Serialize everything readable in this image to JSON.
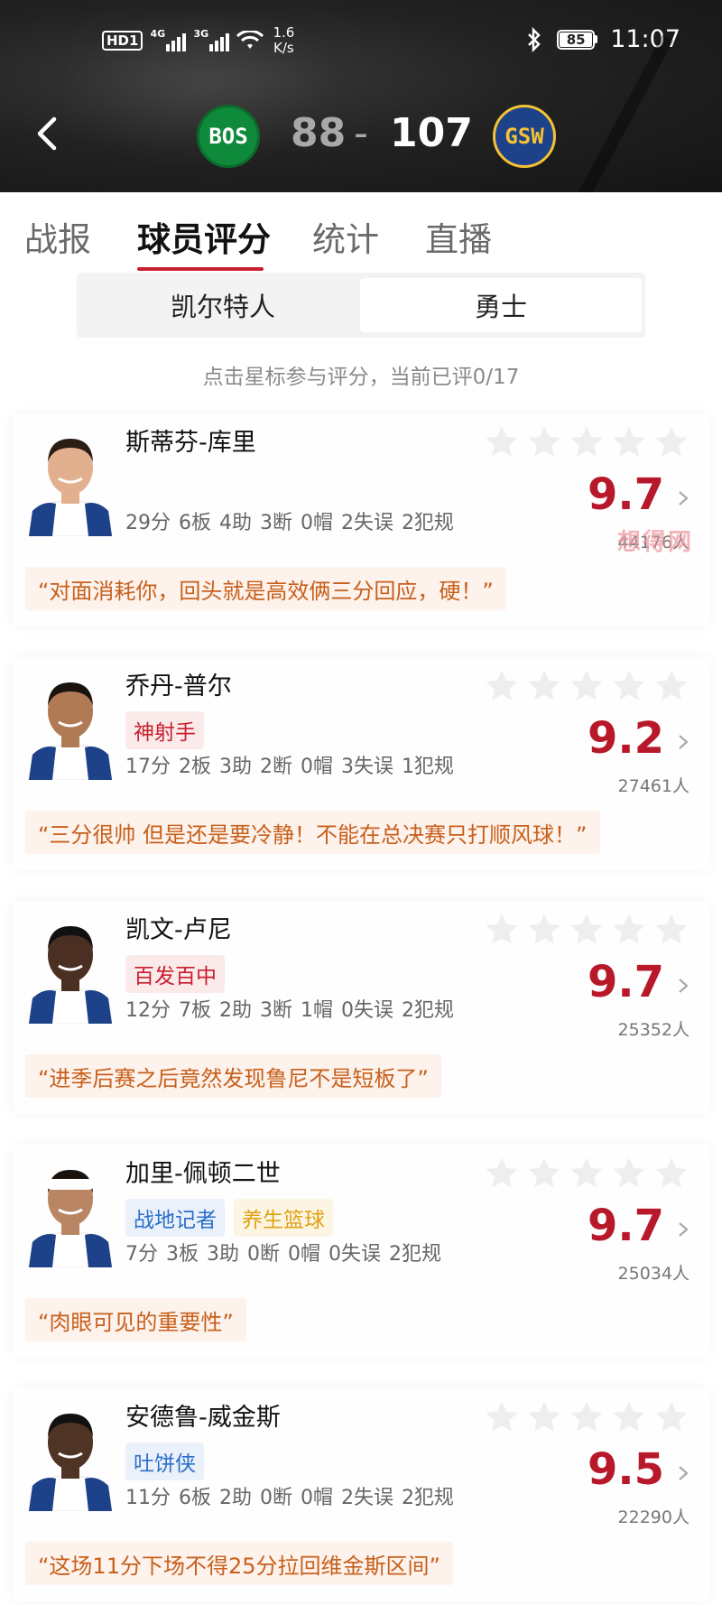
{
  "status_bar": {
    "hd": "HD1",
    "net1": "4G",
    "net2": "3G",
    "speed_value": "1.6",
    "speed_unit": "K/s",
    "battery": "85",
    "time": "11:07"
  },
  "game": {
    "home_abbr": "BOS",
    "home_score": "88",
    "separator": "-",
    "away_abbr": "GSW",
    "away_score": "107",
    "colors": {
      "bos": "#0f8a3a",
      "gsw": "#1d428a",
      "gsw_accent": "#f5c233"
    }
  },
  "tabs": [
    "战报",
    "球员评分",
    "统计",
    "直播"
  ],
  "active_tab": 1,
  "team_switch": {
    "left": "凯尔特人",
    "right": "勇士"
  },
  "hint": "点击星标参与评分，当前已评0/17",
  "players": [
    {
      "name": "斯蒂芬-库里",
      "tags": [],
      "stats": "29分 6板 4助 3断 0帽 2失误 2犯规",
      "rating": "9.7",
      "voters": "44176人",
      "quote": "“对面消耗你，回头就是高效俩三分回应，硬！”"
    },
    {
      "name": "乔丹-普尔",
      "tags": [
        {
          "label": "神射手",
          "color": "red"
        }
      ],
      "stats": "17分 2板 3助 2断 0帽 3失误 1犯规",
      "rating": "9.2",
      "voters": "27461人",
      "quote": "“三分很帅 但是还是要冷静！不能在总决赛只打顺风球！”"
    },
    {
      "name": "凯文-卢尼",
      "tags": [
        {
          "label": "百发百中",
          "color": "red"
        }
      ],
      "stats": "12分 7板 2助 3断 1帽 0失误 2犯规",
      "rating": "9.7",
      "voters": "25352人",
      "quote": "“进季后赛之后竟然发现鲁尼不是短板了”"
    },
    {
      "name": "加里-佩顿二世",
      "tags": [
        {
          "label": "战地记者",
          "color": "blue"
        },
        {
          "label": "养生篮球",
          "color": "yellow"
        }
      ],
      "stats": "7分 3板 3助 0断 0帽 0失误 2犯规",
      "rating": "9.7",
      "voters": "25034人",
      "quote": "“肉眼可见的重要性”"
    },
    {
      "name": "安德鲁-威金斯",
      "tags": [
        {
          "label": "吐饼侠",
          "color": "blue"
        }
      ],
      "stats": "11分 6板 2助 0断 0帽 2失误 2犯规",
      "rating": "9.5",
      "voters": "22290人",
      "quote": "“这场11分下场不得25分拉回维金斯区间”"
    }
  ],
  "watermark": "想得网",
  "accent_color": "#c81e2e"
}
